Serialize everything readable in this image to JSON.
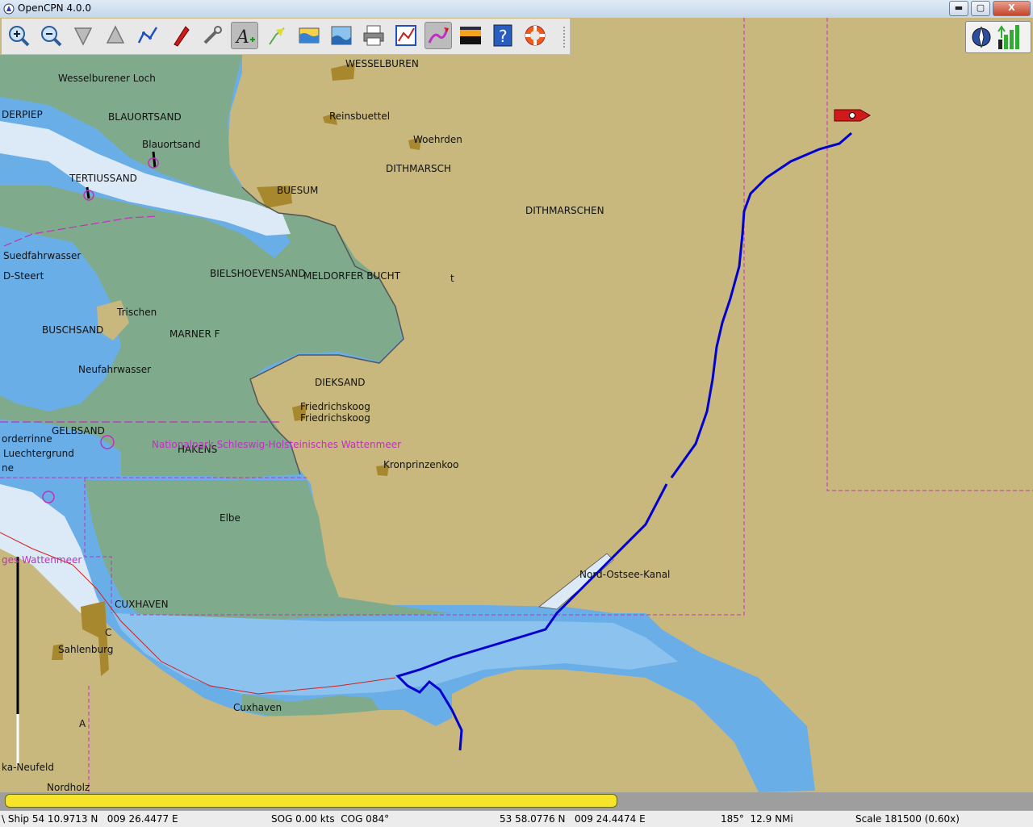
{
  "window": {
    "title": "OpenCPN 4.0.0",
    "buttons": {
      "minimize": "▬",
      "maximize": "▢",
      "close": "X"
    }
  },
  "toolbar": {
    "tools": [
      {
        "name": "zoom-in-icon"
      },
      {
        "name": "zoom-out-icon"
      },
      {
        "name": "scale-down-icon"
      },
      {
        "name": "scale-up-icon"
      },
      {
        "name": "route-icon"
      },
      {
        "name": "auto-follow-icon"
      },
      {
        "name": "settings-icon"
      },
      {
        "name": "text-icon",
        "active": true
      },
      {
        "name": "current-icon"
      },
      {
        "name": "tide-icon"
      },
      {
        "name": "chart-quilting-icon"
      },
      {
        "name": "print-icon"
      },
      {
        "name": "route-manager-icon"
      },
      {
        "name": "track-icon",
        "active": true
      },
      {
        "name": "color-scheme-icon"
      },
      {
        "name": "help-icon"
      },
      {
        "name": "mob-icon"
      }
    ]
  },
  "chart_labels": {
    "wesselburener_loch": "Wesselburener Loch",
    "derpiep": "DERPIEP",
    "blauortsand": "BLAUORTSAND",
    "blauortsand2": "Blauortsand",
    "tertiussand": "TERTIUSSAND",
    "suedfahrwasser": "Suedfahrwasser",
    "d_steert": "D-Steert",
    "buschsand": "BUSCHSAND",
    "trischen": "Trischen",
    "marner": "MARNER F",
    "neufahrwasser": "Neufahrwasser",
    "gelbsand": "GELBSAND",
    "norderrinne": "orderrinne",
    "luechtergrund": "Luechtergrund",
    "ne": "ne",
    "hakens": "HAKENS",
    "nationalpark": "Nationalpark Schleswig-Holsteinisches Wattenmeer",
    "wattenmeer": "ges Wattenmeer",
    "wesselburen": "WESSELBUREN",
    "reinsbuettel": "Reinsbuettel",
    "woehrden": "Woehrden",
    "dithmarsch": "DITHMARSCH",
    "dithmarschen": "DITHMARSCHEN",
    "buesum": "BUESUM",
    "bielshoevensand": "BIELSHOEVENSAND",
    "meldorfer_bucht": "MELDORFER BUCHT",
    "t": "t",
    "dieksand": "DIEKSAND",
    "friedrichskoog": "Friedrichskoog",
    "friedrichskoog2": "Friedrichskoog",
    "kronprinzenkoog": "Kronprinzenkoo",
    "elbe": "Elbe",
    "nord_ostsee_kanal": "Nord-Ostsee-Kanal",
    "cuxhaven_caps": "CUXHAVEN",
    "c": "C",
    "sahlenburg": "Sahlenburg",
    "cuxhaven": "Cuxhaven",
    "a": "A",
    "neufeld": "ka-Neufeld",
    "nordholz": "Nordholz"
  },
  "status": {
    "ship": "\\ Ship 54 10.9713 N   009 26.4477 E",
    "sog_cog": "SOG 0.00 kts  COG 084°",
    "cursor": "53 58.0776 N   009 24.4474 E",
    "bearing": "185°  12.9 NMi",
    "scale": "Scale 181500 (0.60x)"
  },
  "colors": {
    "land": "#c8b87e",
    "intertidal": "#7fab8c",
    "shallow": "#6aaee8",
    "deep_channel": "#dce9f6",
    "track": "#0000d0",
    "ship": "#d01a1a",
    "boundary": "#c030c0"
  }
}
